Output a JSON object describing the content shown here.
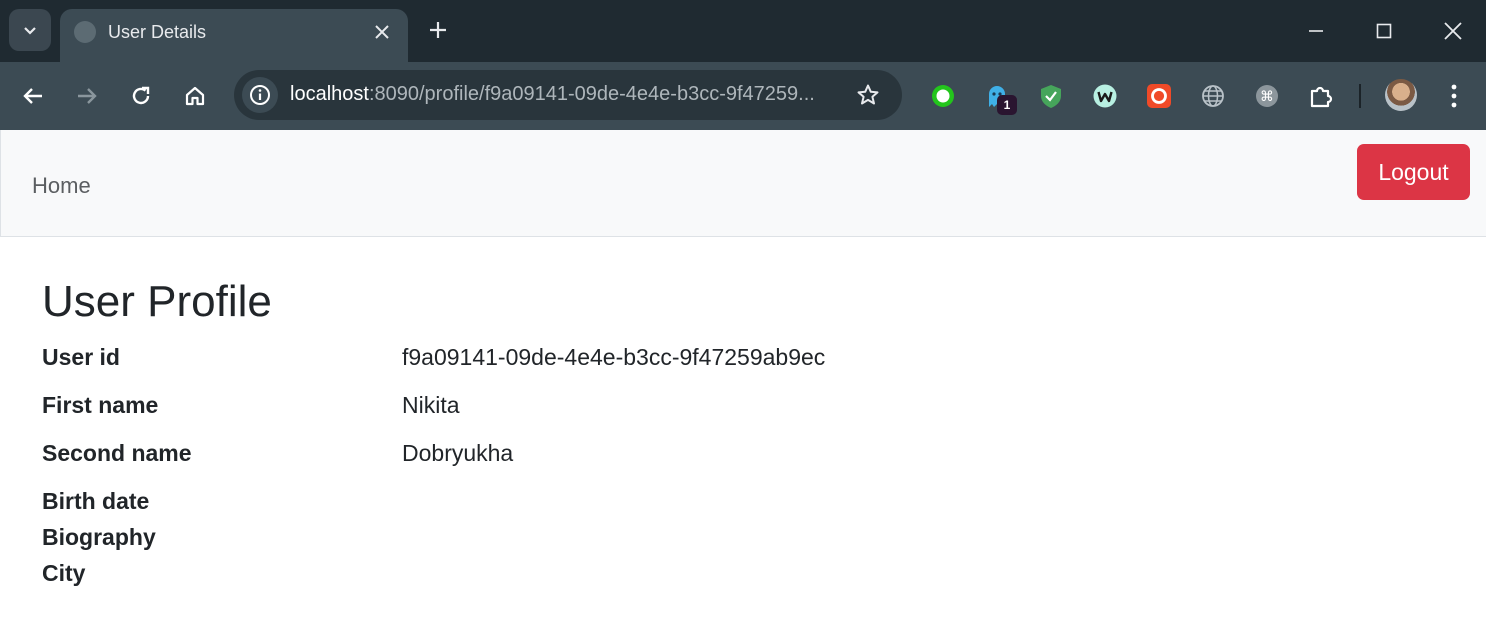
{
  "browser": {
    "tab_title": "User Details",
    "url_host": "localhost",
    "url_rest": ":8090/profile/f9a09141-09de-4e4e-b3cc-9f47259...",
    "extension_badge": "1"
  },
  "navbar": {
    "home_label": "Home",
    "logout_label": "Logout"
  },
  "profile": {
    "title": "User Profile",
    "fields": [
      {
        "label": "User id",
        "value": "f9a09141-09de-4e4e-b3cc-9f47259ab9ec"
      },
      {
        "label": "First name",
        "value": "Nikita"
      },
      {
        "label": "Second name",
        "value": "Dobryukha"
      },
      {
        "label": "Birth date",
        "value": ""
      },
      {
        "label": "Biography",
        "value": ""
      },
      {
        "label": "City",
        "value": ""
      }
    ]
  },
  "colors": {
    "logout_bg": "#dc3545",
    "navbar_bg": "#f8f9fa",
    "chrome_toolbar": "#3c4b54",
    "chrome_tabbar": "#1f2a31"
  }
}
